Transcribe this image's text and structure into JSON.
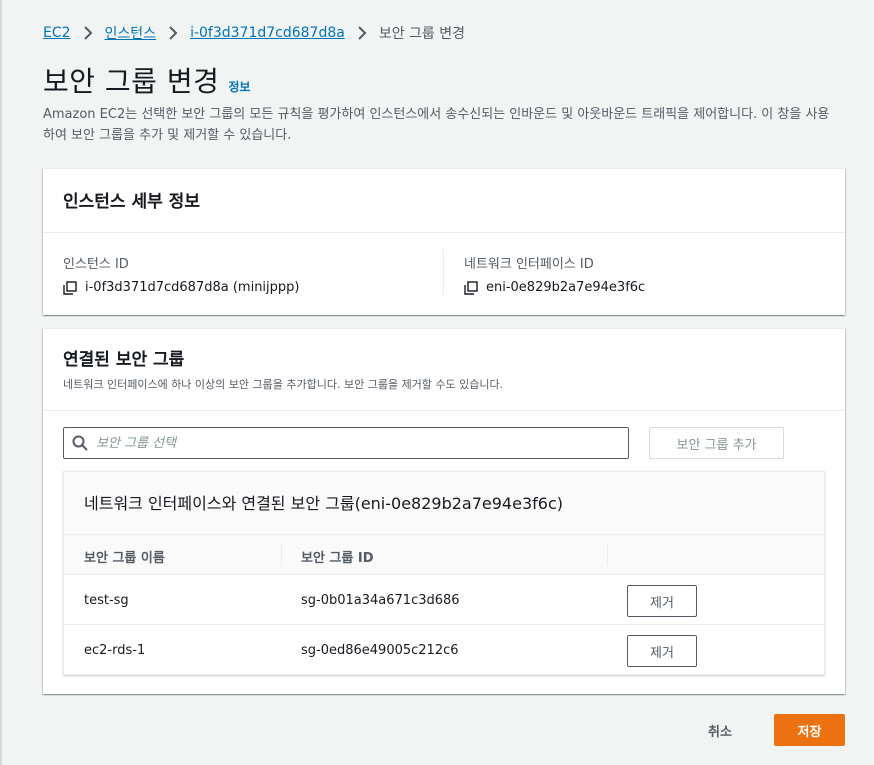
{
  "breadcrumb": {
    "items": [
      "EC2",
      "인스턴스",
      "i-0f3d371d7cd687d8a"
    ],
    "current": "보안 그룹 변경"
  },
  "page": {
    "title": "보안 그룹 변경",
    "info_link": "정보",
    "description": "Amazon EC2는 선택한 보안 그룹의 모든 규칙을 평가하여 인스턴스에서 송수신되는 인바운드 및 아웃바운드 트래픽을 제어합니다. 이 창을 사용하여 보안 그룹을 추가 및 제거할 수 있습니다."
  },
  "instance_details": {
    "title": "인스턴스 세부 정보",
    "instance_id_label": "인스턴스 ID",
    "instance_id_value": "i-0f3d371d7cd687d8a (minijppp)",
    "eni_label": "네트워크 인터페이스 ID",
    "eni_value": "eni-0e829b2a7e94e3f6c"
  },
  "security_groups": {
    "title": "연결된 보안 그룹",
    "description": "네트워크 인터페이스에 하나 이상의 보안 그룹을 추가합니다. 보안 그룹을 제거할 수도 있습니다.",
    "search_placeholder": "보안 그룹 선택",
    "add_button": "보안 그룹 추가",
    "table_title": "네트워크 인터페이스와 연결된 보안 그룹(eni-0e829b2a7e94e3f6c)",
    "columns": [
      "보안 그룹 이름",
      "보안 그룹 ID"
    ],
    "rows": [
      {
        "name": "test-sg",
        "id": "sg-0b01a34a671c3d686",
        "action": "제거"
      },
      {
        "name": "ec2-rds-1",
        "id": "sg-0ed86e49005c212c6",
        "action": "제거"
      }
    ]
  },
  "footer": {
    "cancel": "취소",
    "save": "저장"
  },
  "colors": {
    "link": "#0073bb",
    "primary_button": "#ec7211",
    "background": "#f2f3f3"
  }
}
